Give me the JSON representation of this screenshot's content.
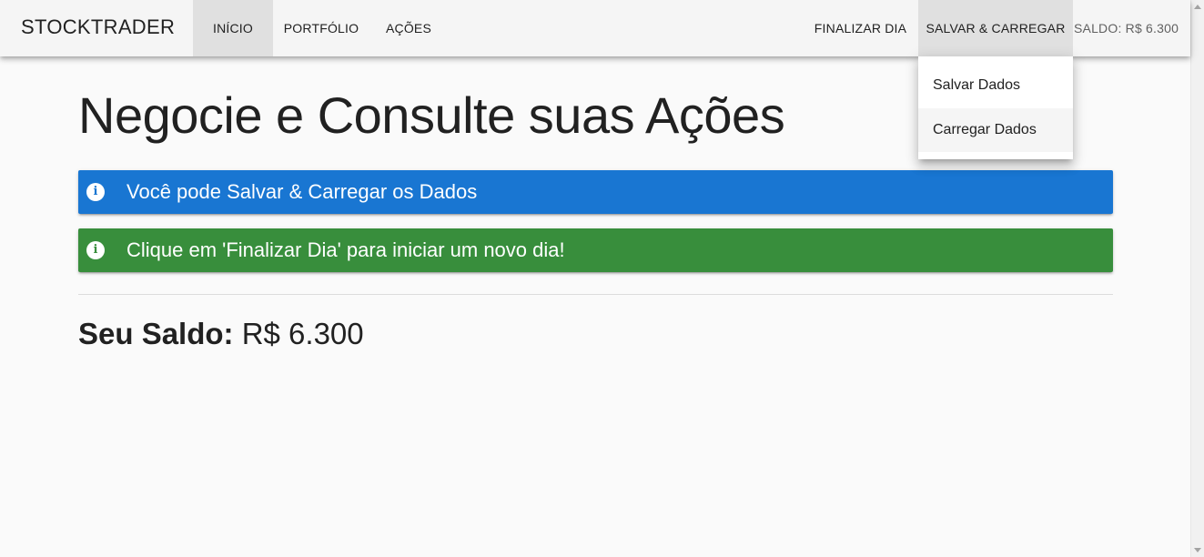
{
  "toolbar": {
    "brand_bold": "STOCK",
    "brand_light": "TRADER",
    "nav": {
      "inicio": "Início",
      "portfolio": "Portfólio",
      "acoes": "Ações"
    },
    "finalizar_dia": "Finalizar Dia",
    "salvar_carregar": "Salvar & Carregar",
    "saldo": "Saldo: R$ 6.300"
  },
  "menu": {
    "items": [
      "Salvar Dados",
      "Carregar Dados"
    ]
  },
  "main": {
    "title": "Negocie e Consulte suas Ações",
    "alerts": [
      {
        "icon": "info-icon",
        "text": "Você pode Salvar & Carregar os Dados",
        "color": "#1976d2"
      },
      {
        "icon": "info-icon",
        "text": "Clique em 'Finalizar Dia' para iniciar um novo dia!",
        "color": "#388e3c"
      }
    ],
    "saldo_label": "Seu Saldo:",
    "saldo_value": "R$ 6.300"
  },
  "colors": {
    "toolbar_bg": "#f5f5f5",
    "active_bg": "#e0e0e0",
    "page_bg": "#fafafa"
  }
}
